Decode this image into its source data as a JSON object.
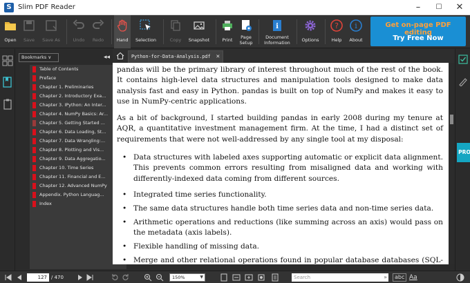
{
  "window": {
    "title": "Slim PDF Reader",
    "app_icon": "S",
    "controls": [
      "–",
      "☐",
      "✕"
    ]
  },
  "toolbar": {
    "open": "Open",
    "save": "Save",
    "save_as": "Save As",
    "undo": "Undo",
    "redo": "Redo",
    "hand": "Hand",
    "selection": "Selection",
    "copy": "Copy",
    "snapshot": "Snapshot",
    "print": "Print",
    "page_setup_1": "Page",
    "page_setup_2": "Setup",
    "doc_info_1": "Document",
    "doc_info_2": "Information",
    "options": "Options",
    "help": "Help",
    "about": "About"
  },
  "promo": {
    "line1": "Get on-page PDF editing",
    "line2": "Try Free Now"
  },
  "bookmarks": {
    "dropdown": "Bookmarks ∨",
    "collapse": "◂◂",
    "items": [
      "Table of Contents",
      "Preface",
      "Chapter 1. Preliminaries",
      "Chapter 2. Introductory Exa...",
      "Chapter 3. IPython: An Inter...",
      "Chapter 4. NumPy Basics: Ar...",
      "Chapter 5. Getting Started ...",
      "Chapter 6. Data Loading, St...",
      "Chapter 7. Data Wrangling:...",
      "Chapter 8. Plotting and Vis...",
      "Chapter 9. Data Aggregatio...",
      "Chapter 10. Time Series",
      "Chapter 11. Financial and E...",
      "Chapter 12. Advanced NumPy",
      "Appendix. Python Languag...",
      "Index"
    ],
    "selected_index": 6
  },
  "tab": {
    "filename": "Python-for-Data-Analysis.pdf",
    "close": "✕"
  },
  "document": {
    "p1": "pandas will be the primary library of interest throughout much of the rest of the book. It contains high-level data structures and manipulation tools designed to make data analysis fast and easy in Python. pandas is built on top of NumPy and makes it easy to use in NumPy-centric applications.",
    "p2": "As a bit of background, I started building pandas in early 2008 during my tenure at AQR, a quantitative investment management firm. At the time, I had a distinct set of requirements that were not well-addressed by any single tool at my disposal:",
    "bullets": [
      "Data structures with labeled axes supporting automatic or explicit data alignment. This prevents common errors resulting from misaligned data and working with differently-indexed data coming from different sources.",
      "Integrated time series functionality.",
      "The same data structures handle both time series data and non-time series data.",
      "Arithmetic operations and reductions (like summing across an axis) would pass on the metadata (axis labels).",
      "Flexible handling of missing data.",
      "Merge and other relational operations found in popular database databases (SQL-based, for example)."
    ]
  },
  "right_rail": {
    "pro": "PRO"
  },
  "statusbar": {
    "page_current": "127",
    "page_total": "/ 470",
    "zoom": "150%",
    "search_placeholder": "Search",
    "abc": "abc",
    "aa": "Aa"
  },
  "colors": {
    "accent": "#1a8fd4",
    "promo_orange": "#ffa03a",
    "bookmark_flag": "#d9101b",
    "pro_tab": "#15a6c2"
  }
}
